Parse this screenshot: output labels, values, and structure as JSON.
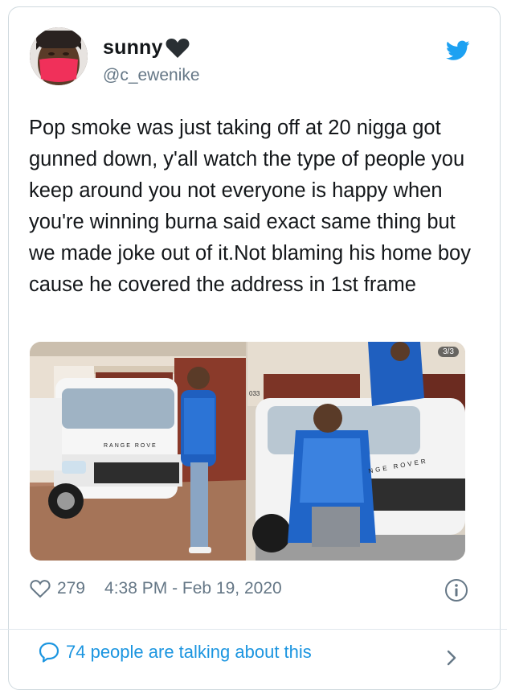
{
  "tweet": {
    "display_name": "sunny",
    "handle": "@c_ewenike",
    "text": "Pop smoke was just taking off at 20 nigga got gunned down, y'all watch the type of people you keep around you not everyone is happy when you're winning burna said exact same thing but we made joke out of it.Not blaming his home boy cause he covered the address in 1st frame",
    "media_counter": "3/3",
    "photo1_text": "RANGE ROVE",
    "photo2_text": "NGE ROVER",
    "photo2_wall_number": "033",
    "likes": "279",
    "timestamp": "4:38 PM - Feb 19, 2020",
    "talking": "74 people are talking about this"
  },
  "icons": {
    "heart_emoji": "black-heart-icon",
    "brand": "twitter-bird-icon",
    "like": "heart-outline-icon",
    "info": "info-icon",
    "reply": "speech-bubble-icon",
    "more": "chevron-right-icon"
  },
  "colors": {
    "twitter_blue": "#1da1f2",
    "link_blue": "#1b95e0",
    "text": "#14171a",
    "muted": "#657786",
    "border": "#cfd9de"
  }
}
